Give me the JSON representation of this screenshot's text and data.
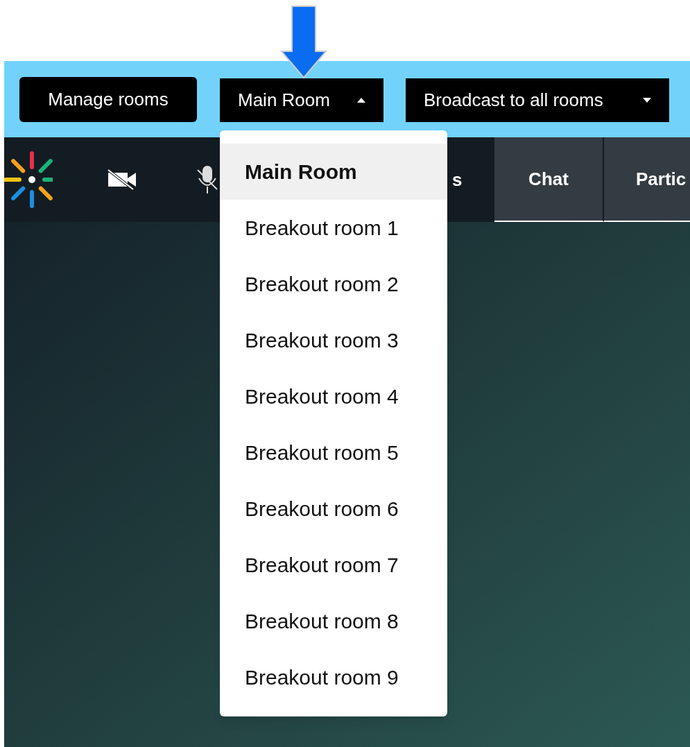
{
  "room_bar": {
    "buttons": [
      {
        "label": "Manage rooms",
        "kind": "plain"
      },
      {
        "label": "Main Room",
        "kind": "dropdown",
        "expanded": true
      },
      {
        "label": "Broadcast to all rooms",
        "kind": "dropdown",
        "expanded": false
      }
    ]
  },
  "toolbar": {
    "hidden_text": "s",
    "tabs": [
      {
        "label": "Chat"
      },
      {
        "label": "Partic"
      }
    ]
  },
  "room_menu": {
    "items": [
      {
        "label": "Main Room",
        "selected": true
      },
      {
        "label": "Breakout room 1",
        "selected": false
      },
      {
        "label": "Breakout room 2",
        "selected": false
      },
      {
        "label": "Breakout room 3",
        "selected": false
      },
      {
        "label": "Breakout room 4",
        "selected": false
      },
      {
        "label": "Breakout room 5",
        "selected": false
      },
      {
        "label": "Breakout room 6",
        "selected": false
      },
      {
        "label": "Breakout room 7",
        "selected": false
      },
      {
        "label": "Breakout room 8",
        "selected": false
      },
      {
        "label": "Breakout room 9",
        "selected": false
      }
    ]
  }
}
